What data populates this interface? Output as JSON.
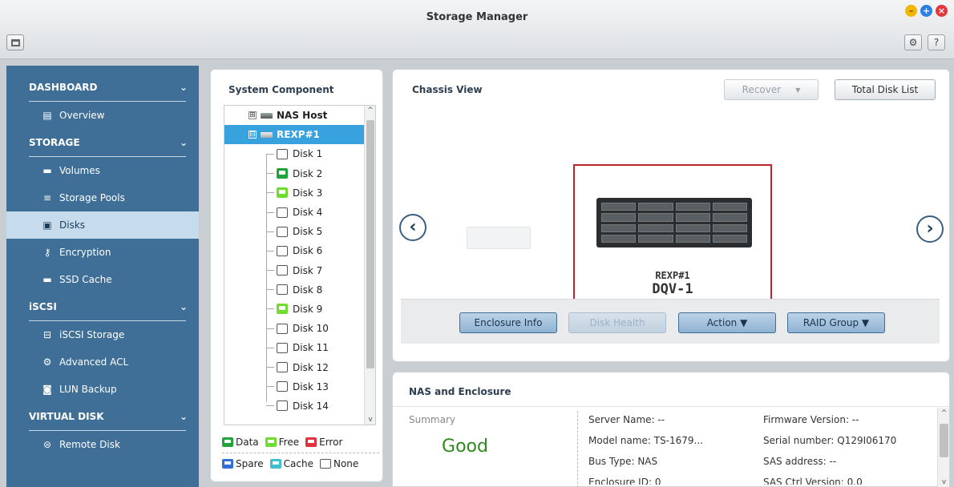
{
  "window": {
    "title": "Storage Manager",
    "min_icon": "minimize-icon",
    "max_icon": "maximize-icon",
    "close_icon": "close-icon"
  },
  "toolbar": {
    "settings_icon": "gear-icon",
    "help_label": "?"
  },
  "sidebar": {
    "sections": [
      {
        "label": "DASHBOARD",
        "items": [
          {
            "label": "Overview",
            "icon": "overview-icon"
          }
        ]
      },
      {
        "label": "STORAGE",
        "items": [
          {
            "label": "Volumes",
            "icon": "volume-icon"
          },
          {
            "label": "Storage Pools",
            "icon": "storage-pool-icon"
          },
          {
            "label": "Disks",
            "icon": "disk-icon",
            "active": true
          },
          {
            "label": "Encryption",
            "icon": "key-icon"
          },
          {
            "label": "SSD Cache",
            "icon": "ssd-icon"
          }
        ]
      },
      {
        "label": "iSCSI",
        "items": [
          {
            "label": "iSCSI Storage",
            "icon": "iscsi-storage-icon"
          },
          {
            "label": "Advanced ACL",
            "icon": "gear-icon"
          },
          {
            "label": "LUN Backup",
            "icon": "lun-backup-icon"
          }
        ]
      },
      {
        "label": "VIRTUAL DISK",
        "items": [
          {
            "label": "Remote Disk",
            "icon": "remote-disk-icon"
          }
        ]
      }
    ]
  },
  "system_component": {
    "title": "System Component",
    "tree": [
      {
        "label": "NAS Host",
        "toggle": "⊞"
      },
      {
        "label": "REXP#1",
        "toggle": "⊟"
      }
    ],
    "disks": [
      {
        "label": "Disk 1",
        "status": "none"
      },
      {
        "label": "Disk 2",
        "status": "data"
      },
      {
        "label": "Disk 3",
        "status": "free"
      },
      {
        "label": "Disk 4",
        "status": "none"
      },
      {
        "label": "Disk 5",
        "status": "none"
      },
      {
        "label": "Disk 6",
        "status": "none"
      },
      {
        "label": "Disk 7",
        "status": "none"
      },
      {
        "label": "Disk 8",
        "status": "none"
      },
      {
        "label": "Disk 9",
        "status": "free"
      },
      {
        "label": "Disk 10",
        "status": "none"
      },
      {
        "label": "Disk 11",
        "status": "none"
      },
      {
        "label": "Disk 12",
        "status": "none"
      },
      {
        "label": "Disk 13",
        "status": "none"
      },
      {
        "label": "Disk 14",
        "status": "none"
      }
    ],
    "legend": [
      [
        {
          "label": "Data",
          "color": "#1fa33a"
        },
        {
          "label": "Free",
          "color": "#6fdc2f"
        },
        {
          "label": "Error",
          "color": "#e0323c"
        }
      ],
      [
        {
          "label": "Spare",
          "color": "#2f6fd6"
        },
        {
          "label": "Cache",
          "color": "#3fbfcf"
        },
        {
          "label": "None",
          "color": "none"
        }
      ]
    ]
  },
  "chassis": {
    "title": "Chassis View",
    "recover_label": "Recover",
    "total_disk_label": "Total Disk List",
    "device_name": "REXP#1",
    "device_id": "DQV-1",
    "actions": {
      "enclosure_info": "Enclosure Info",
      "disk_health": "Disk Health",
      "action": "Action ▼",
      "raid_group": "RAID Group ▼"
    }
  },
  "nas": {
    "title": "NAS and Enclosure",
    "summary_label": "Summary",
    "summary_value": "Good",
    "fields": [
      "Server Name: --",
      "Model name: TS-1679...",
      "Bus Type: NAS",
      "Enclosure ID: 0",
      "Firmware Version: --",
      "Serial number: Q129I06170",
      "SAS address: --",
      "SAS Ctrl Version: 0.0"
    ]
  },
  "colors": {
    "sidebar_bg": "#3f6f96",
    "active_item": "#c6dcec",
    "selected_tree": "#37a2dd",
    "good_status": "#2f8a1e",
    "frame_red": "#b8252d"
  }
}
